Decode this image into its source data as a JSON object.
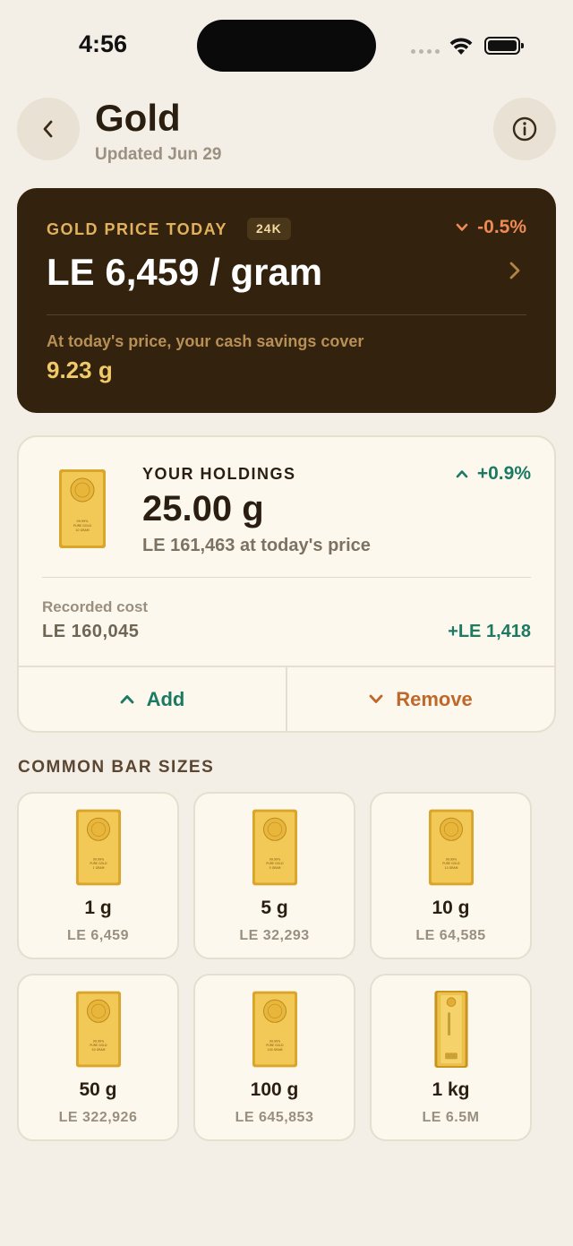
{
  "status_bar": {
    "time": "4:56"
  },
  "header": {
    "title": "Gold",
    "subtitle": "Updated Jun 29"
  },
  "price_card": {
    "label": "GOLD PRICE TODAY",
    "karat": "24K",
    "change": "-0.5%",
    "value": "LE 6,459 / gram",
    "cover_text": "At today's price, your cash savings cover",
    "cover_value": "9.23 g"
  },
  "holdings": {
    "label": "YOUR HOLDINGS",
    "change": "+0.9%",
    "value": "25.00 g",
    "subtitle": "LE 161,463 at today's price",
    "cost_label": "Recorded cost",
    "cost_value": "LE 160,045",
    "gain": "+LE 1,418",
    "add_label": "Add",
    "remove_label": "Remove"
  },
  "bars_section": {
    "title": "COMMON BAR SIZES",
    "items": [
      {
        "weight": "1 g",
        "price": "LE 6,459"
      },
      {
        "weight": "5 g",
        "price": "LE 32,293"
      },
      {
        "weight": "10 g",
        "price": "LE 64,585"
      },
      {
        "weight": "50 g",
        "price": "LE 322,926"
      },
      {
        "weight": "100 g",
        "price": "LE 645,853"
      },
      {
        "weight": "1 kg",
        "price": "LE 6.5M"
      }
    ]
  },
  "bar_image": {
    "purity": "99.99%",
    "metal": "PURE GOLD",
    "mass": [
      "1 GRAM",
      "5 GRAM",
      "10 GRAM",
      "50 GRAM",
      "100 GRAM",
      "10 GRAM"
    ]
  },
  "colors": {
    "background": "#f3efe7",
    "card_dark": "#32220e",
    "accent_gold": "#e2b15c",
    "positive": "#1c7a63",
    "negative": "#ee8a52",
    "remove": "#c0682a"
  }
}
